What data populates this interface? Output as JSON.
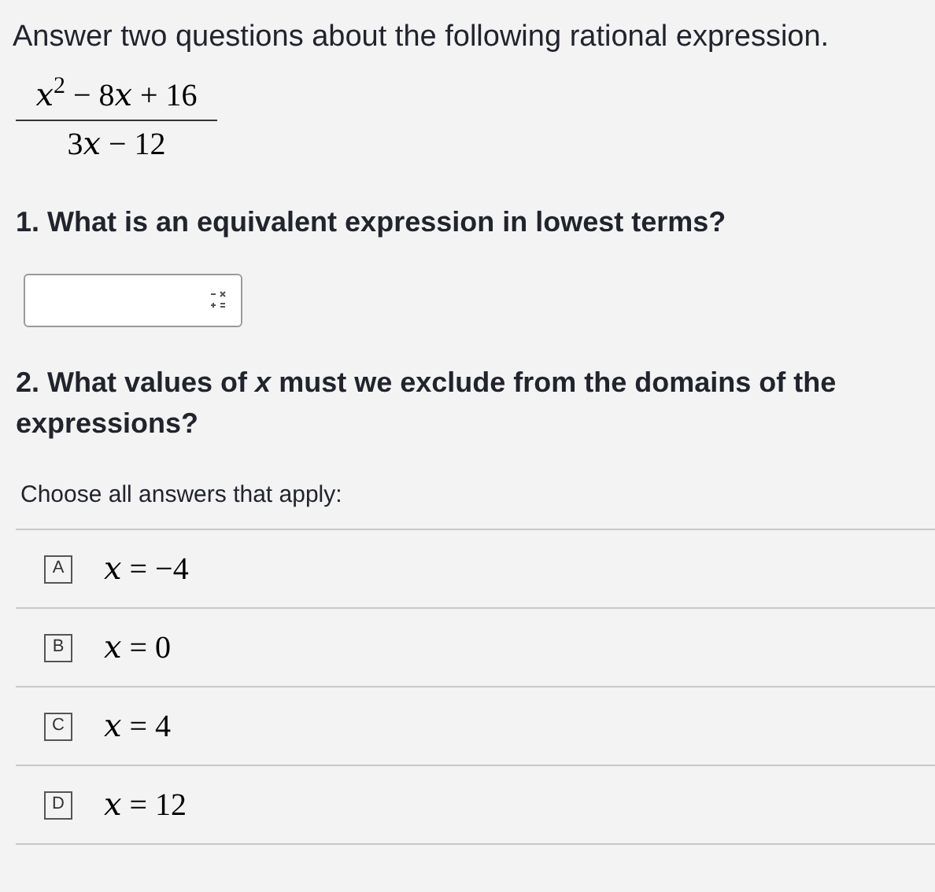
{
  "prompt": "Answer two questions about the following rational expression.",
  "expression": {
    "numerator": "𝑥$^{2}$ − 8𝑥 + 16",
    "denominator": "3𝑥 − 12"
  },
  "questions": [
    {
      "kind": "input",
      "text": "1. What is an equivalent expression in lowest terms?"
    },
    {
      "kind": "choices",
      "text": "2. What values of *x* must we exclude from the domains of the expressions?",
      "instruction": "Choose all answers that apply:",
      "choices": [
        {
          "letter": "A",
          "text": "𝑥 = −4",
          "selected": false
        },
        {
          "letter": "B",
          "text": "𝑥 = 0",
          "selected": false
        },
        {
          "letter": "C",
          "text": "𝑥 = 4",
          "selected": false
        },
        {
          "letter": "D",
          "text": "𝑥 = 12",
          "selected": false
        }
      ]
    }
  ]
}
